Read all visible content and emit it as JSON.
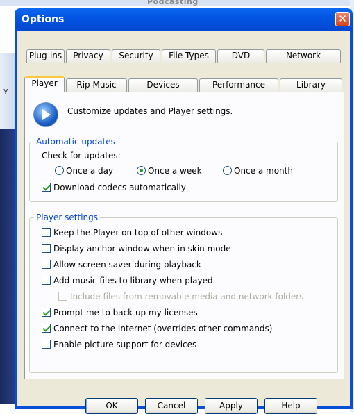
{
  "background": {
    "top_text": "Podcasting",
    "side_letter": "y"
  },
  "dialog": {
    "title": "Options",
    "close_glyph": "✕"
  },
  "tabs_row1": [
    "Plug-ins",
    "Privacy",
    "Security",
    "File Types",
    "DVD",
    "Network"
  ],
  "tabs_row2": [
    "Player",
    "Rip Music",
    "Devices",
    "Performance",
    "Library"
  ],
  "active_tab": "Player",
  "header": {
    "icon": "media-player-icon",
    "text": "Customize updates and Player settings."
  },
  "automatic_updates": {
    "legend": "Automatic updates",
    "check_label": "Check for updates:",
    "options": [
      {
        "label": "Once a day",
        "selected": false
      },
      {
        "label": "Once a week",
        "selected": true
      },
      {
        "label": "Once a month",
        "selected": false
      }
    ],
    "download_codecs": {
      "label": "Download codecs automatically",
      "checked": true
    }
  },
  "player_settings": {
    "legend": "Player settings",
    "items": [
      {
        "label": "Keep the Player on top of other windows",
        "checked": false,
        "disabled": false
      },
      {
        "label": "Display anchor window when in skin mode",
        "checked": false,
        "disabled": false
      },
      {
        "label": "Allow screen saver during playback",
        "checked": false,
        "disabled": false
      },
      {
        "label": "Add music files to library when played",
        "checked": false,
        "disabled": false
      },
      {
        "label": "Include files from removable media and network folders",
        "checked": false,
        "disabled": true
      },
      {
        "label": "Prompt me to back up my licenses",
        "checked": true,
        "disabled": false
      },
      {
        "label": "Connect to the Internet (overrides other commands)",
        "checked": true,
        "disabled": false
      },
      {
        "label": "Enable picture support for devices",
        "checked": false,
        "disabled": false
      }
    ]
  },
  "buttons": {
    "ok": "OK",
    "cancel": "Cancel",
    "apply": "Apply",
    "help": "Help"
  },
  "colors": {
    "title_bar": "#0355e3",
    "legend_text": "#0046d5",
    "highlight_ring": "#e02020",
    "check_mark": "#21a121"
  }
}
